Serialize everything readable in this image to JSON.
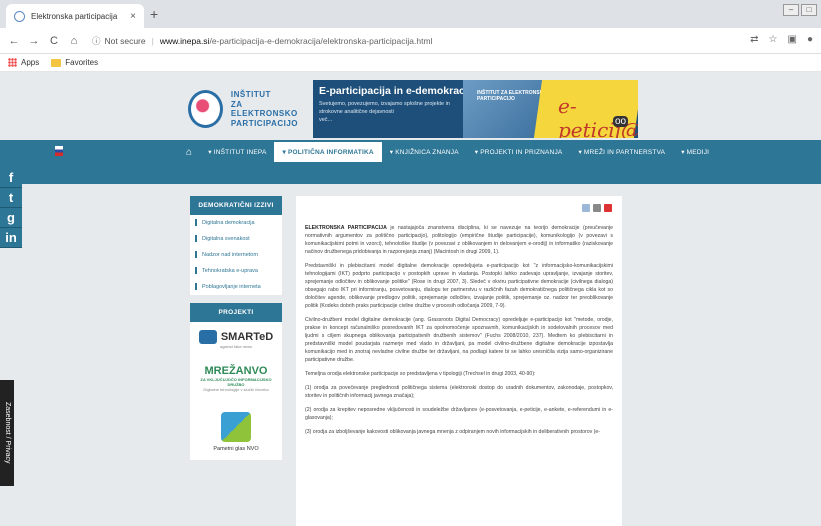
{
  "browser": {
    "tab_title": "Elektronska participacija",
    "tab_close": "×",
    "new_tab": "+",
    "url_info_label": "Not secure",
    "url_host": "www.inepa.si",
    "url_path": "/e-participacija-e-demokracija/elektronska-participacija.html",
    "bookmarks": {
      "apps": "Apps",
      "favorites": "Favorites"
    }
  },
  "header": {
    "logo_text": [
      "INŠTITUT",
      "ZA",
      "ELEKTRONSKO",
      "PARTICIPACIJO"
    ],
    "banner_title": "E-participacija in e-demokracija",
    "banner_text": "Svetujemo, povezujemo, izvajamo splošne projekte in strokovne analitične dejavnosti",
    "banner_more": "več...",
    "banner_mini": "INŠTITUT ZA ELEKTRONSKO PARTICIPACIJO",
    "banner_ep": "e-peticij@"
  },
  "nav": {
    "items": [
      "INŠTITUT INEPA",
      "POLITIČNA INFORMATIKA",
      "KNJIŽNICA ZNANJA",
      "PROJEKTI IN PRIZNANJA",
      "MREŽI IN PARTNERSTVA",
      "MEDIJI"
    ]
  },
  "social": [
    "f",
    "t",
    "g",
    "in"
  ],
  "privacy_label": "Zasebnost / Privacy",
  "sidebar": {
    "block1_title": "DEMOKRATIČNI IZZIVI",
    "block1_items": [
      "Digitalna demokracija",
      "Digitalna svenakost",
      "Nadzor nad internetom",
      "Tehnokratska e-uprava",
      "Poblagovljanje interneta"
    ],
    "block2_title": "PROJEKTI",
    "smarted": "SMARTeD",
    "smarted_sub": "against fake news",
    "mrezanvo": "MREŽANVO",
    "mrezanvo_sub": "ZA VKLJUČUJOČO INFORMACIJSKO DRUŽBO",
    "mrezanvo_caption": "Digitalne tehnologije v službi človeka",
    "nvo_label": "Pametni glas NVO"
  },
  "content": {
    "p1_bold": "ELEKTRONSKA PARTICIPACIJA",
    "p1": " je nastajajoča znanstvena disciplina, ki se navezuje na teorijo demokracije (preučevanje normativnih argumentov za politično participacijo), politologijo (empirične študije participacije), komunikologijo (v povezavi s komunikacijskimi potmi in vzorci), tehnološke študije (v povezavi z oblikovanjem in delovanjem e-orodij) in informatiko (raziskovanje načinov družbenega pridobivanja in razporejanja znanj) (Macintosh in drugi 2009, 1).",
    "p2": "Predstavniški in plebiscitarni model digitalne demokracije opredeljujeta e-participacijo kot \"z informacijsko-komunikacijskimi tehnologijami (IKT) podprto participacijo v postopkih uprave in vladanja. Postopki lahko zadevajo upravljanje, izvajanje storitev, sprejemanje odločitev in oblikovanje politike\" (Rose in drugi 2007, 3). Sledeč v okviru participativne demokracije (civilnega dialoga) obsegajo rabo IKT pri informiranju, posvetovanju, dialogu ter partnerstvu v različnih fazah demokratičnega političnega cikla kot so določitev agende, oblikovanje predlogov politik, sprejemanje odločitev, izvajanje politik, sprejemanje oz. nadzor ter preoblikovanje politik (Kodeks dobrih praks participacije civilne družbe v procesih odločanja 2009, 7-9).",
    "p3": "Civilno-družbeni model digitalne demokracije (ang. Grassroots Digital Democracy) opredeljuje e-participacijo kot \"metode, orodje, prakse in koncept računalniško posredovanih IKT za opolnomočenje spoznavnih, komunikacijskih in sodelovalnih procesov med ljudmi s ciljem skupnega oblikovanja participativnih družbenih sistemov\" (Fuchs 2008/2010, 237). Medtem ko plebiscitarni in predstavniški model poudarjata razmerje med vlado in državljani, pa model civilno-družbene digitalne demokracije izpostavlja komunikacijo med in znotraj nevladne civilne družbe ter državljani, na podlagi katere bi se lahko uresničila vizija samo-organizirane participativne družbe.",
    "p4": "Temeljna orodja elektronske participacije so predstavljena v tipologiji (Trechsel in drugi 2003, 40-90):",
    "p5": "(1) orodja za povečevanje preglednosti političnega sistema (elektronski dostop do uradnih dokumentov, zakonodaje, postopkov, storitev in političnih informacij javnega značaja);",
    "p6": "(2) orodja za krepitev neposredne vključenosti in soudeležbe državljanov (e-posvetovanja, e-peticije, e-ankete, e-referendumi in e-glasovanja);",
    "p7": "(3) orodja za izboljševanje kakovosti oblikovanja javnega mnenja z odpiranjem novih informacijskih in deliberativnih prostorov (e-"
  }
}
